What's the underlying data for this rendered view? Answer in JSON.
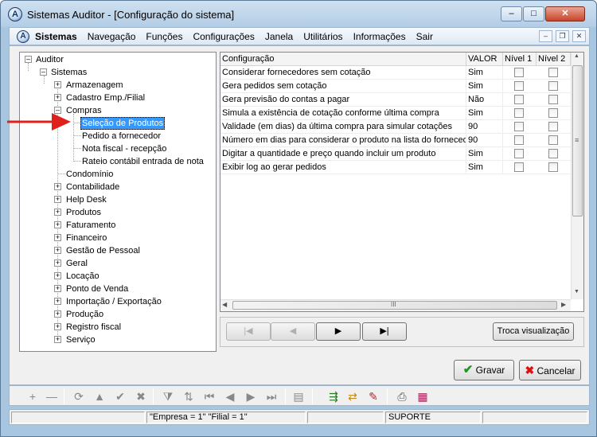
{
  "window": {
    "title": "Sistemas Auditor - [Configuração do sistema]",
    "app_icon_letter": "A",
    "buttons": {
      "minimize": "–",
      "maximize": "□",
      "close": "✕"
    }
  },
  "menubar": {
    "app_name": "Sistemas",
    "items": [
      "Navegação",
      "Funções",
      "Configurações",
      "Janela",
      "Utilitários",
      "Informações",
      "Sair"
    ],
    "mdi": {
      "minimize": "–",
      "restore": "❐",
      "close": "✕"
    }
  },
  "tree": {
    "nodes": [
      {
        "label": "Auditor",
        "toggle": "–"
      },
      {
        "label": "Sistemas",
        "toggle": "–"
      },
      {
        "label": "Armazenagem",
        "toggle": "+"
      },
      {
        "label": "Cadastro Emp./Filial",
        "toggle": "+"
      },
      {
        "label": "Compras",
        "toggle": "–"
      },
      {
        "label": "Seleção de Produtos",
        "toggle": ""
      },
      {
        "label": "Pedido a fornecedor",
        "toggle": ""
      },
      {
        "label": "Nota fiscal - recepção",
        "toggle": ""
      },
      {
        "label": "Rateio contábil entrada de nota",
        "toggle": ""
      },
      {
        "label": "Condomínio",
        "toggle": ""
      },
      {
        "label": "Contabilidade",
        "toggle": "+"
      },
      {
        "label": "Help Desk",
        "toggle": "+"
      },
      {
        "label": "Produtos",
        "toggle": "+"
      },
      {
        "label": "Faturamento",
        "toggle": "+"
      },
      {
        "label": "Financeiro",
        "toggle": "+"
      },
      {
        "label": "Gestão de Pessoal",
        "toggle": "+"
      },
      {
        "label": "Geral",
        "toggle": "+"
      },
      {
        "label": "Locação",
        "toggle": "+"
      },
      {
        "label": "Ponto de Venda",
        "toggle": "+"
      },
      {
        "label": "Importação / Exportação",
        "toggle": "+"
      },
      {
        "label": "Produção",
        "toggle": "+"
      },
      {
        "label": "Registro fiscal",
        "toggle": "+"
      },
      {
        "label": "Serviço",
        "toggle": "+"
      }
    ],
    "selected": "Seleção de Produtos"
  },
  "grid": {
    "columns": [
      "Configuração",
      "VALOR",
      "Nível 1",
      "Nível 2"
    ],
    "rows": [
      {
        "config": "Considerar fornecedores sem cotação",
        "valor": "Sim"
      },
      {
        "config": "Gera pedidos sem cotação",
        "valor": "Sim"
      },
      {
        "config": "Gera previsão do contas a pagar",
        "valor": "Não"
      },
      {
        "config": "Simula a existência de cotação conforme última compra",
        "valor": "Sim"
      },
      {
        "config": "Validade (em dias) da última compra para simular cotações",
        "valor": "90"
      },
      {
        "config": "Número em dias para considerar o produto na lista do fornecedor",
        "valor": "90"
      },
      {
        "config": "Digitar a quantidade e preço quando incluir um produto",
        "valor": "Sim"
      },
      {
        "config": "Exibir log ao gerar pedidos",
        "valor": "Sim"
      }
    ],
    "scroll_glyphs": {
      "up": "▲",
      "down": "▼",
      "left": "◀",
      "right": "▶",
      "grip_v": "≡",
      "grip_h": "III"
    }
  },
  "navigator": {
    "first": "|◀",
    "prev": "◀",
    "next": "▶",
    "last": "▶|",
    "toggle_view": "Troca visualização"
  },
  "actions": {
    "save": "Gravar",
    "cancel": "Cancelar",
    "save_icon": "✔",
    "cancel_icon": "✖"
  },
  "toolbar": {
    "icons": [
      "+",
      "—",
      "⟳",
      "▲",
      "✔",
      "✖",
      "⧩",
      "⇅",
      "⏮",
      "◀",
      "▶",
      "⏭",
      "▤",
      "⇶",
      "⇄",
      "✎",
      "⎙",
      "▦"
    ]
  },
  "statusbar": {
    "panel1": "",
    "panel2": "\"Empresa = 1\"   \"Filial = 1\"",
    "panel3": "",
    "panel4": "SUPORTE",
    "panel5": ""
  },
  "colors": {
    "selection": "#3399ff",
    "arrow": "#e0201b",
    "window_frame": "#a9c6e0"
  }
}
